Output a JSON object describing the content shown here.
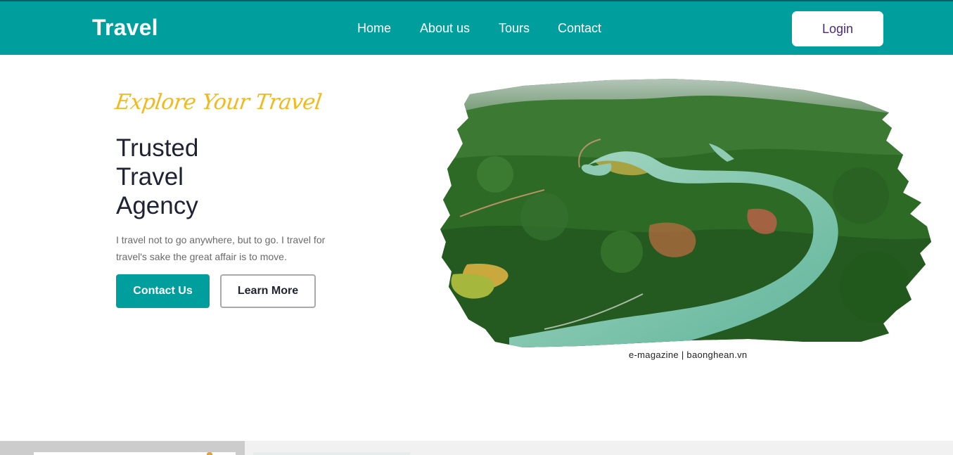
{
  "header": {
    "brand": "Travel",
    "nav": [
      {
        "label": "Home"
      },
      {
        "label": "About us"
      },
      {
        "label": "Tours"
      },
      {
        "label": "Contact"
      }
    ],
    "login_label": "Login"
  },
  "hero": {
    "tagline": "Explore Your Travel",
    "headline_lines": [
      "Trusted",
      "Travel",
      "Agency"
    ],
    "description": "I travel not to go anywhere, but to go. I travel for travel's sake the great affair is to move.",
    "primary_button": "Contact Us",
    "secondary_button": "Learn More",
    "image_caption": "e-magazine | baonghean.vn"
  },
  "colors": {
    "brand": "#009e9c",
    "accent": "#f3b81a",
    "heading": "#1f2233",
    "login_text": "#4b2a77"
  }
}
